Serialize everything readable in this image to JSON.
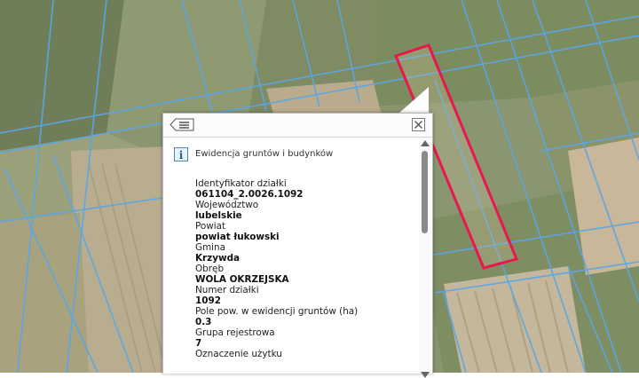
{
  "map": {
    "parcel_highlight_color": "#e8174f",
    "parcel_boundary_color": "#5aa6e8"
  },
  "popup": {
    "menu_icon": "list-icon",
    "close_icon": "close-icon",
    "layer": {
      "icon": "info-icon",
      "icon_glyph": "i",
      "title": "Ewidencja gruntów i budynków"
    },
    "fields": [
      {
        "label": "Identyfikator działki",
        "value": "061104_2.0026.1092"
      },
      {
        "label": "Województwo",
        "value": "lubelskie"
      },
      {
        "label": "Powiat",
        "value": "powiat łukowski"
      },
      {
        "label": "Gmina",
        "value": "Krzywda"
      },
      {
        "label": "Obręb",
        "value": "WOLA OKRZEJSKA"
      },
      {
        "label": "Numer działki",
        "value": "1092"
      },
      {
        "label": "Pole pow. w ewidencji gruntów (ha)",
        "value": "0.3"
      },
      {
        "label": "Grupa rejestrowa",
        "value": "7"
      },
      {
        "label": "Oznaczenie użytku",
        "value": ""
      }
    ]
  }
}
